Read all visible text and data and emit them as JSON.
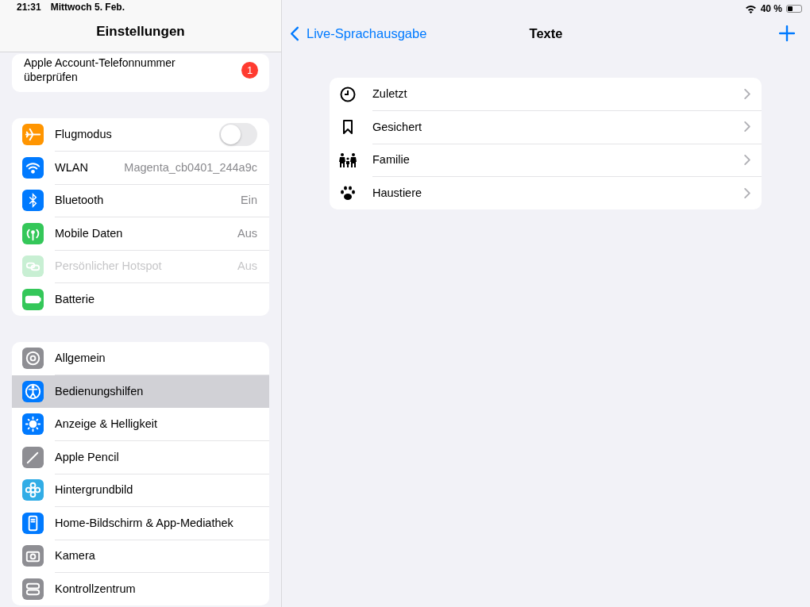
{
  "status_bar": {
    "time": "21:31",
    "date": "Mittwoch 5. Feb.",
    "battery_text": "40 %"
  },
  "sidebar": {
    "title": "Einstellungen",
    "groups": [
      {
        "items": [
          {
            "kind": "alert",
            "label": "Apple Account-Telefonnummer überprüfen",
            "badge": "1",
            "selected": false
          }
        ]
      },
      {
        "items": [
          {
            "kind": "toggle",
            "color": "#ff9500",
            "label": "Flugmodus",
            "on": false,
            "disabled": false,
            "selected": false
          },
          {
            "kind": "link",
            "color": "#007aff",
            "label": "WLAN",
            "value": "Magenta_cb0401_244a9c",
            "disabled": false,
            "selected": false
          },
          {
            "kind": "link",
            "color": "#007aff",
            "label": "Bluetooth",
            "value": "Ein",
            "disabled": false,
            "selected": false
          },
          {
            "kind": "link",
            "color": "#34c759",
            "label": "Mobile Daten",
            "value": "Aus",
            "disabled": false,
            "selected": false
          },
          {
            "kind": "link",
            "color": "#c8efd3",
            "label": "Persönlicher Hotspot",
            "value": "Aus",
            "disabled": true,
            "selected": false
          },
          {
            "kind": "link",
            "color": "#34c759",
            "label": "Batterie",
            "disabled": false,
            "selected": false
          }
        ]
      },
      {
        "items": [
          {
            "kind": "link",
            "color": "#8e8e93",
            "label": "Allgemein",
            "disabled": false,
            "selected": false
          },
          {
            "kind": "link",
            "color": "#007aff",
            "label": "Bedienungshilfen",
            "disabled": false,
            "selected": true
          },
          {
            "kind": "link",
            "color": "#007aff",
            "label": "Anzeige & Helligkeit",
            "disabled": false,
            "selected": false
          },
          {
            "kind": "link",
            "color": "#8e8e93",
            "label": "Apple Pencil",
            "disabled": false,
            "selected": false
          },
          {
            "kind": "link",
            "color": "#32ade6",
            "label": "Hintergrundbild",
            "disabled": false,
            "selected": false
          },
          {
            "kind": "link",
            "color": "#007aff",
            "label": "Home-Bildschirm & App-Mediathek",
            "disabled": false,
            "selected": false
          },
          {
            "kind": "link",
            "color": "#8e8e93",
            "label": "Kamera",
            "disabled": false,
            "selected": false
          },
          {
            "kind": "link",
            "color": "#8e8e93",
            "label": "Kontrollzentrum",
            "disabled": false,
            "selected": false
          }
        ]
      }
    ]
  },
  "detail": {
    "back_label": "Live-Sprachausgabe",
    "title": "Texte",
    "items": [
      {
        "label": "Zuletzt"
      },
      {
        "label": "Gesichert"
      },
      {
        "label": "Familie"
      },
      {
        "label": "Haustiere"
      }
    ]
  }
}
